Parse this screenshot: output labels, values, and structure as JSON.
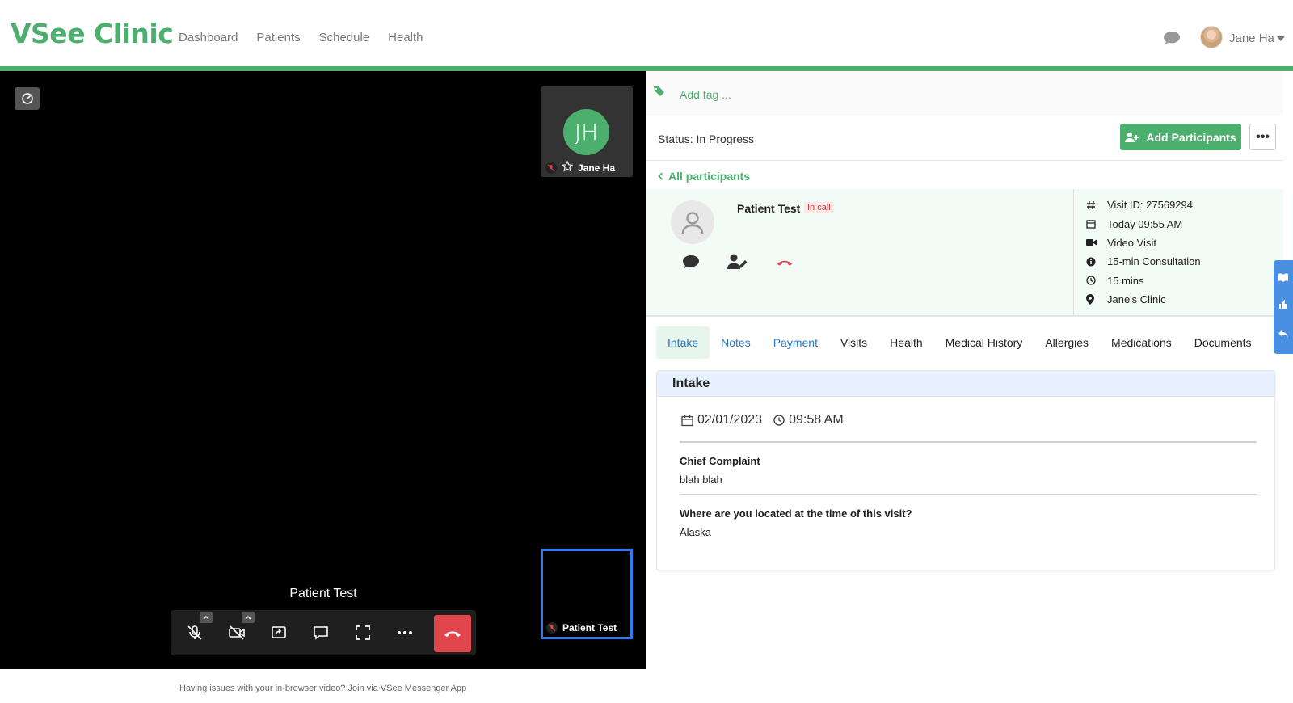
{
  "header": {
    "logo": "VSee Clinic",
    "nav": [
      "Dashboard",
      "Patients",
      "Schedule",
      "Health"
    ],
    "user_name": "Jane Ha"
  },
  "video": {
    "self_initials": "JH",
    "self_name": "Jane Ha",
    "remote_name": "Patient Test",
    "remote_thumb_name": "Patient Test",
    "footer_note": "Having issues with your in-browser video? Join via VSee Messenger App"
  },
  "panel": {
    "add_tag": "Add tag ...",
    "status": "Status: In Progress",
    "add_participants": "Add Participants",
    "more": "•••",
    "all_participants": "All participants",
    "patient_name": "Patient Test",
    "patient_badge": "In call",
    "visit_info": [
      {
        "icon": "hash-icon",
        "text": "Visit ID: 27569294"
      },
      {
        "icon": "calendar-icon",
        "text": "Today 09:55 AM"
      },
      {
        "icon": "video-icon",
        "text": "Video Visit"
      },
      {
        "icon": "info-icon",
        "text": "15-min Consultation"
      },
      {
        "icon": "clock-icon",
        "text": "15 mins"
      },
      {
        "icon": "location-icon",
        "text": "Jane's Clinic"
      }
    ],
    "tabs": [
      "Intake",
      "Notes",
      "Payment",
      "Visits",
      "Health",
      "Medical History",
      "Allergies",
      "Medications",
      "Documents"
    ],
    "active_tab": "Intake"
  },
  "intake": {
    "title": "Intake",
    "date": "02/01/2023",
    "time": "09:58 AM",
    "questions": [
      {
        "label": "Chief Complaint",
        "answer": "blah blah"
      },
      {
        "label": "Where are you located at the time of this visit?",
        "answer": "Alaska"
      }
    ]
  },
  "colors": {
    "brand": "#4caf6e",
    "link_blue": "#2a78c8",
    "hangup": "#e0474c",
    "focus_border": "#2f7bf5"
  }
}
